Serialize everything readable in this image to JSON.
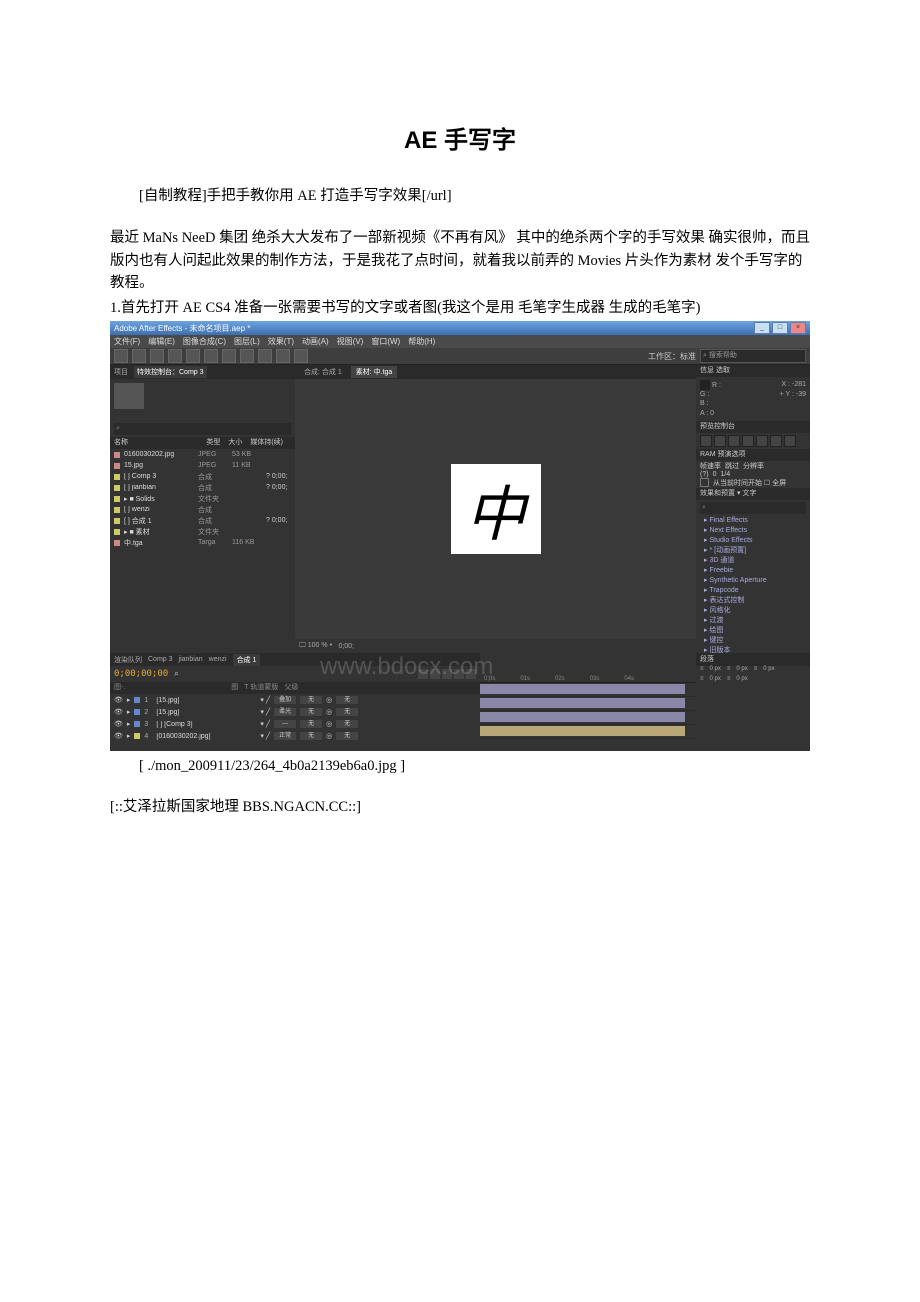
{
  "title": "AE 手写字",
  "intro_line": "[自制教程]手把手教你用 AE 打造手写字效果[/url]",
  "para1": "最近 MaNs NeeD 集团 绝杀大大发布了一部新视频《不再有风》 其中的绝杀两个字的手写效果 确实很帅，而且版内也有人问起此效果的制作方法，于是我花了点时间，就着我以前弄的 Movies 片头作为素材 发个手写字的教程。",
  "para2": "1.首先打开 AE CS4 准备一张需要书写的文字或者图(我这个是用 毛笔字生成器 生成的毛笔字)",
  "app": {
    "title": "Adobe After Effects - 未命名项目.aep *",
    "menu": [
      "文件(F)",
      "编辑(E)",
      "图像合成(C)",
      "图层(L)",
      "效果(T)",
      "动画(A)",
      "视图(V)",
      "窗口(W)",
      "帮助(H)"
    ],
    "workspace_label": "工作区：标准",
    "search_help_placeholder": "搜索帮助",
    "left_tabs": {
      "project": "项目",
      "effect_controls": "特效控制台：Comp 3"
    },
    "proj_search_placeholder": "⌕",
    "proj_cols": {
      "name": "名称",
      "type": "类型",
      "size": "大小",
      "dur": "媒体持(续)"
    },
    "items": [
      {
        "name": "0160030202.jpg",
        "swatch": "s-pink",
        "type": "JPEG",
        "size": "53 KB",
        "dur": ""
      },
      {
        "name": "15.jpg",
        "swatch": "s-pink",
        "type": "JPEG",
        "size": "11 KB",
        "dur": ""
      },
      {
        "name": "[ ] Comp 3",
        "swatch": "s-yellow",
        "type": "合成",
        "size": "",
        "dur": "? 0;00;"
      },
      {
        "name": "[ ] jianbian",
        "swatch": "s-yellow",
        "type": "合成",
        "size": "",
        "dur": "? 0;00;"
      },
      {
        "name": "▸ ■ Solids",
        "swatch": "s-yellow",
        "type": "文件夹",
        "size": "",
        "dur": ""
      },
      {
        "name": "[ ] wenzi",
        "swatch": "s-yellow",
        "type": "合成",
        "size": "",
        "dur": ""
      },
      {
        "name": "[ ] 合成 1",
        "swatch": "s-yellow",
        "type": "合成",
        "size": "",
        "dur": "? 0;00;"
      },
      {
        "name": "▸ ■ 素材",
        "swatch": "s-yellow",
        "type": "文件夹",
        "size": "",
        "dur": ""
      },
      {
        "name": "中.tga",
        "swatch": "s-pink",
        "type": "Targa",
        "size": "116 KB",
        "dur": ""
      }
    ],
    "center_tabs": [
      "合成: 合成 1",
      "素材: 中.tga"
    ],
    "center_active": 1,
    "canvas_char": "中",
    "viewer_footer": {
      "zoom": "100 %",
      "info": "0;00;"
    },
    "watermark": "www.bdocx.com",
    "right": {
      "info_panel": "信息     选取",
      "rgba": {
        "R": "R :",
        "G": "G :",
        "B": "B :",
        "A": "A : 0",
        "X": "X : -281",
        "Y": "Y : -39"
      },
      "preview_panel": "预览控制台",
      "ram_panel": "RAM 预演选项",
      "ram_row1": [
        "帧速率",
        "跳过",
        "分辨率"
      ],
      "ram_row2": [
        "(?)",
        "0",
        "1/4"
      ],
      "ram_check": "从当前时间开始  ☐ 全屏",
      "fx_panel": "效果和预置 ▾ 文字",
      "fx_search": "⌕",
      "fx": [
        "Final Effects",
        "Next Effects",
        "Studio Effects",
        "* [动画预置]",
        "3D 通道",
        "Freebie",
        "Synthetic Aperture",
        "Trapcode",
        "表达式控制",
        "风格化",
        "过渡",
        "绘图",
        "键控",
        "旧版本",
        "■■"
      ]
    },
    "timeline": {
      "tabs": [
        "渲染队列",
        "Comp 3",
        "jianbian",
        "wenzi",
        "合成 1"
      ],
      "active_tab": 4,
      "timecode": "0;00;00;00",
      "tool_labels": [
        "图-.",
        "图",
        "T 轨道蒙版",
        "父级"
      ],
      "ruler": [
        "0;0s",
        "01s",
        "02s",
        "03s",
        "04s"
      ],
      "layers": [
        {
          "num": "1",
          "swatch": "s-blue",
          "name": "[15.jpg]",
          "mode": "叠加",
          "trk": "无",
          "parent": "无"
        },
        {
          "num": "2",
          "swatch": "s-blue",
          "name": "[15.jpg]",
          "mode": "柔光",
          "trk": "无",
          "parent": "无"
        },
        {
          "num": "3",
          "swatch": "s-blue",
          "name": "[ ] [Comp 3]",
          "mode": "—",
          "trk": "无",
          "parent": "无"
        },
        {
          "num": "4",
          "swatch": "s-yellow",
          "name": "[0160030202.jpg]",
          "mode": "正常",
          "trk": "无",
          "parent": "无"
        }
      ],
      "far_right_head": "段落",
      "far_right_rows": [
        [
          "≡",
          "0 px",
          "≡",
          "0 px",
          "≡",
          "0 px"
        ],
        [
          "≡",
          "0 px",
          "≡",
          "0 px"
        ]
      ]
    }
  },
  "caption": "[ ./mon_200911/23/264_4b0a2139eb6a0.jpg ]",
  "footer": "[::艾泽拉斯国家地理 BBS.NGACN.CC::]"
}
